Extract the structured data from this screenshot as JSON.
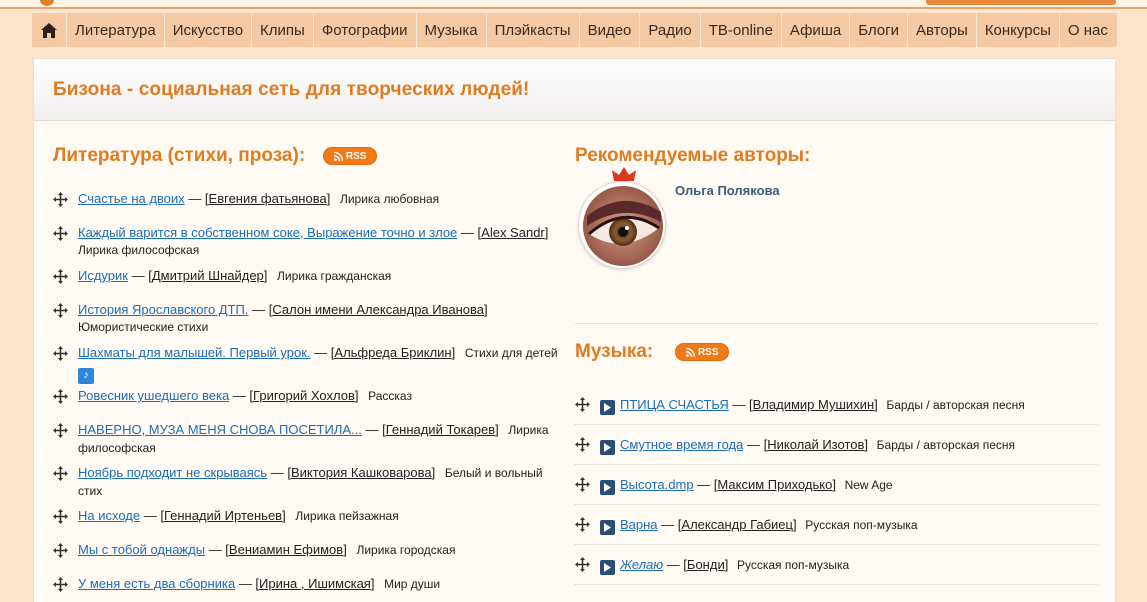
{
  "nav": {
    "items": [
      "Литература",
      "Искусство",
      "Клипы",
      "Фотографии",
      "Музыка",
      "Плэйкасты",
      "Видео",
      "Радио",
      "ТВ-online",
      "Афиша",
      "Блоги",
      "Авторы",
      "Конкурсы",
      "О нас"
    ]
  },
  "banner": {
    "title": "Бизона - социальная сеть для творческих людей!"
  },
  "literature": {
    "title": "Литература (стихи, проза):",
    "rss_label": "RSS",
    "items": [
      {
        "title": "Счастье на двоих",
        "author": "Евгения фатьянова",
        "genre": "Лирика любовная"
      },
      {
        "title": "Каждый варится в собственном соке, Выражение точно и злое",
        "author": "Alex Sandr",
        "genre": "Лирика философская"
      },
      {
        "title": "Исдурик",
        "author": "Дмитрий Шнайдер",
        "genre": "Лирика гражданская"
      },
      {
        "title": "История Ярославского ДТП.",
        "author": "Салон имени Александра Иванова",
        "genre": "Юмористические стихи"
      },
      {
        "title": "Шахматы для малышей. Первый урок.",
        "author": "Альфреда Бриклин",
        "genre": "Стихи для детей"
      },
      {
        "title": "Ровесник ушедшего века",
        "author": "Григорий Хохлов",
        "genre": "Рассказ"
      },
      {
        "title": "НАВЕРНО, МУЗА МЕНЯ СНОВА ПОСЕТИЛА...",
        "author": "Геннадий Токарев",
        "genre": "Лирика философская"
      },
      {
        "title": "Ноябрь подходит не скрываясь",
        "author": "Виктория Кашковарова",
        "genre": "Белый и вольный стих"
      },
      {
        "title": "На исходе",
        "author": "Геннадий Иртеньев",
        "genre": "Лирика пейзажная"
      },
      {
        "title": "Мы с тобой однажды",
        "author": "Вениамин Ефимов",
        "genre": "Лирика городская"
      },
      {
        "title": "У меня есть два сборника",
        "author": "Ирина , Ишимская",
        "genre": "Мир души"
      }
    ]
  },
  "recommended": {
    "title": "Рекомендуемые авторы:",
    "author_name": "Ольга Полякова"
  },
  "music": {
    "title": "Музыка:",
    "rss_label": "RSS",
    "items": [
      {
        "title": "ПТИЦА СЧАСТЬЯ",
        "author": "Владимир Мушихин",
        "genre": "Барды / авторская песня"
      },
      {
        "title": "Смутное время года",
        "author": "Николай Изотов",
        "genre": "Барды / авторская песня"
      },
      {
        "title": "Высота.dmp",
        "author": "Максим Приходько",
        "genre": "New Age"
      },
      {
        "title": "Варна",
        "author": "Александр Габиец",
        "genre": "Русская поп-музыка"
      },
      {
        "title": "Желаю",
        "author": "Бонди",
        "genre": "Русская поп-музыка"
      }
    ]
  },
  "colors": {
    "accent": "#e07c1f",
    "nav_bg": "#f5c9a3",
    "link": "#1c6db4",
    "rss": "#f07a18",
    "play": "#2c4e75"
  },
  "icons": [
    "home-icon",
    "rss-icon",
    "move-icon",
    "music-note-icon",
    "play-icon",
    "crown-icon"
  ]
}
